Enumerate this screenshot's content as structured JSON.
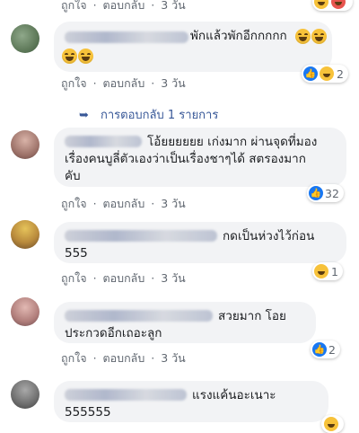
{
  "actions": {
    "like": "ถูกใจ",
    "reply": "ตอบกลับ",
    "sep": "·"
  },
  "comments": [
    {
      "time": "3 วัน"
    },
    {
      "text": "พักแล้วพักอีกกกกก",
      "time": "3 วัน",
      "reaction_count": "2"
    },
    {
      "text_line1": "โอ้ยยยยยย เก่งมาก ผ่านจุดที่มอง",
      "text_line2": "เรื่องคนบูลี่ตัวเองว่าเป็นเรื่องชาๆได้ สตรองมาก",
      "text_line3": "คับ",
      "time": "3 วัน",
      "reaction_count": "32"
    },
    {
      "text_line1": "กดเป็นห่วงไว้ก่อน",
      "text_line2": "555",
      "time": "3 วัน",
      "reaction_count": "1"
    },
    {
      "text_line1": "สวยมาก โอย",
      "text_line2": "ประกวดอีกเถอะลูก",
      "time": "3 วัน",
      "reaction_count": "2"
    },
    {
      "text_line1": "แรงแค้นอะเนาะ",
      "text_line2": "555555"
    }
  ],
  "replies_link": "การตอบกลับ 1 รายการ",
  "colors": {
    "link": "#385898",
    "meta": "#606770",
    "bubble": "#f2f3f5",
    "like_blue": "#1877f2"
  }
}
